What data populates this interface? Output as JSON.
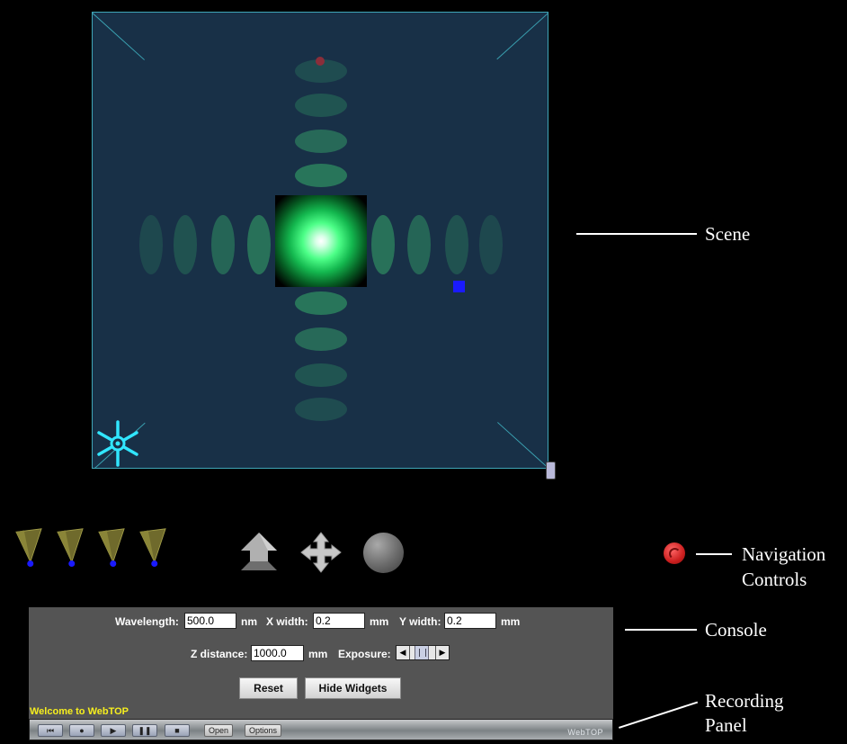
{
  "labels": {
    "scene": "Scene",
    "navigation": [
      "Navigation",
      "Controls"
    ],
    "console": "Console",
    "recording": [
      "Recording",
      "Panel"
    ]
  },
  "console": {
    "wavelength_label": "Wavelength:",
    "wavelength_value": "500.0",
    "wavelength_unit": "nm",
    "xwidth_label": "X width:",
    "xwidth_value": "0.2",
    "xwidth_unit": "mm",
    "ywidth_label": "Y width:",
    "ywidth_value": "0.2",
    "ywidth_unit": "mm",
    "zdistance_label": "Z distance:",
    "zdistance_value": "1000.0",
    "zdistance_unit": "mm",
    "exposure_label": "Exposure:",
    "reset_label": "Reset",
    "hide_widgets_label": "Hide Widgets"
  },
  "welcome": "Welcome to WebTOP",
  "recording": {
    "open_label": "Open",
    "options_label": "Options",
    "brand": "WebTOP"
  },
  "colors": {
    "scene_bg": "#183047",
    "scene_border": "#3fa6b8",
    "welcome_text": "#f7ef1e",
    "console_bg": "#545454"
  },
  "icons": {
    "camera_views": [
      "camera-view-icon",
      "camera-view-icon",
      "camera-view-icon",
      "camera-view-icon"
    ],
    "nav": [
      "walk-arrow-icon",
      "pan-arrows-icon",
      "examine-sphere-icon"
    ],
    "scene_widget": "spoked-wheel-icon",
    "recording": [
      "rewind-icon",
      "record-icon",
      "play-icon",
      "pause-icon",
      "stop-icon"
    ]
  }
}
